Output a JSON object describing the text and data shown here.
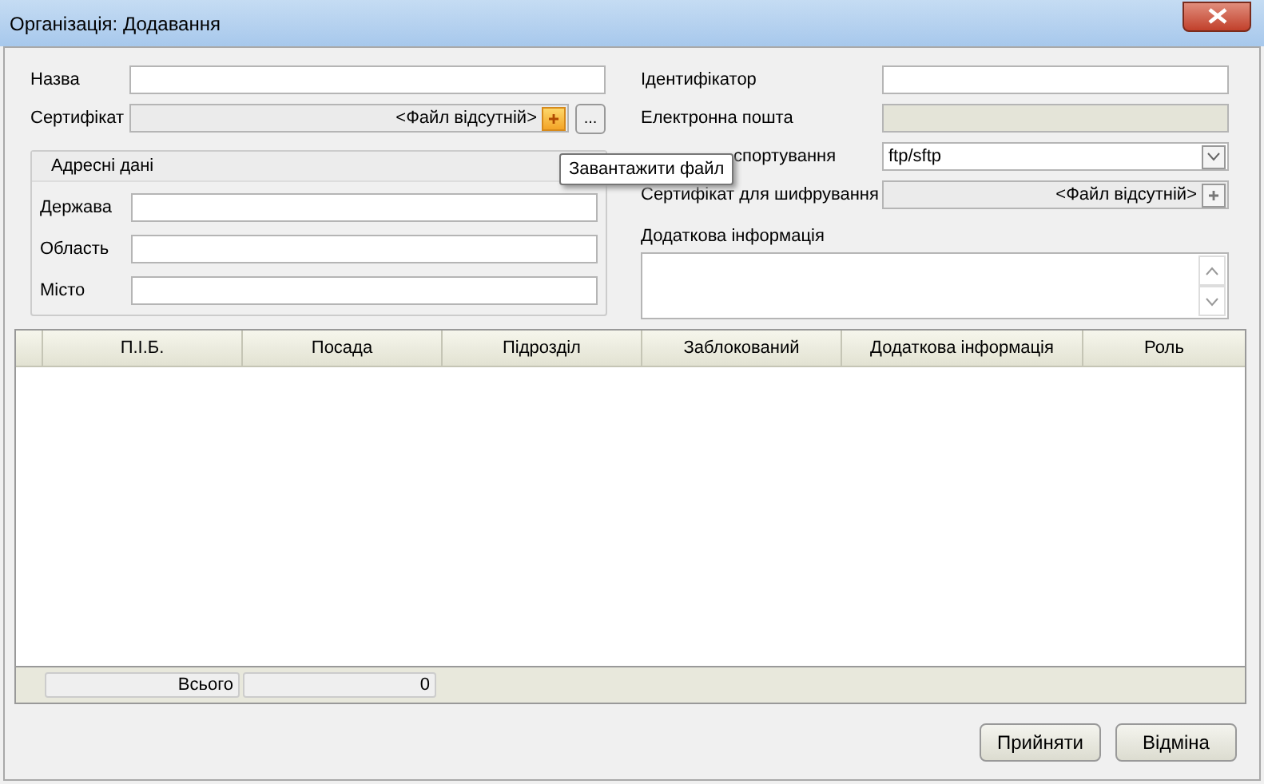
{
  "window": {
    "title": "Організація: Додавання"
  },
  "left_fields": [
    {
      "kind": "text",
      "label": "Назва",
      "disabled": false
    },
    {
      "kind": "file",
      "label": "Сертифікат",
      "value": "<Файл відсутній>",
      "browse": "..."
    }
  ],
  "address": {
    "title": "Адресні дані",
    "fields": [
      {
        "kind": "text",
        "label": "Держава",
        "disabled": false
      },
      {
        "kind": "text",
        "label": "Область",
        "disabled": false
      },
      {
        "kind": "text",
        "label": "Місто",
        "disabled": false
      }
    ]
  },
  "right_fields": [
    {
      "kind": "text",
      "label": "Ідентифікатор",
      "disabled": false
    },
    {
      "kind": "text",
      "label": "Електронна пошта",
      "disabled": true
    },
    {
      "kind": "select",
      "label": "спортування",
      "value": "ftp/sftp"
    },
    {
      "kind": "file",
      "label": "Сертифікат для шифрування",
      "value": "<Файл відсутній>"
    }
  ],
  "notes": {
    "label": "Додаткова інформація"
  },
  "tooltip": "Завантажити файл",
  "table": {
    "columns": [
      "П.І.Б.",
      "Посада",
      "Підрозділ",
      "Заблокований",
      "Додаткова інформація",
      "Роль"
    ]
  },
  "footer": {
    "total_label": "Всього",
    "total_value": "0"
  },
  "buttons": [
    "Прийняти",
    "Відміна"
  ]
}
